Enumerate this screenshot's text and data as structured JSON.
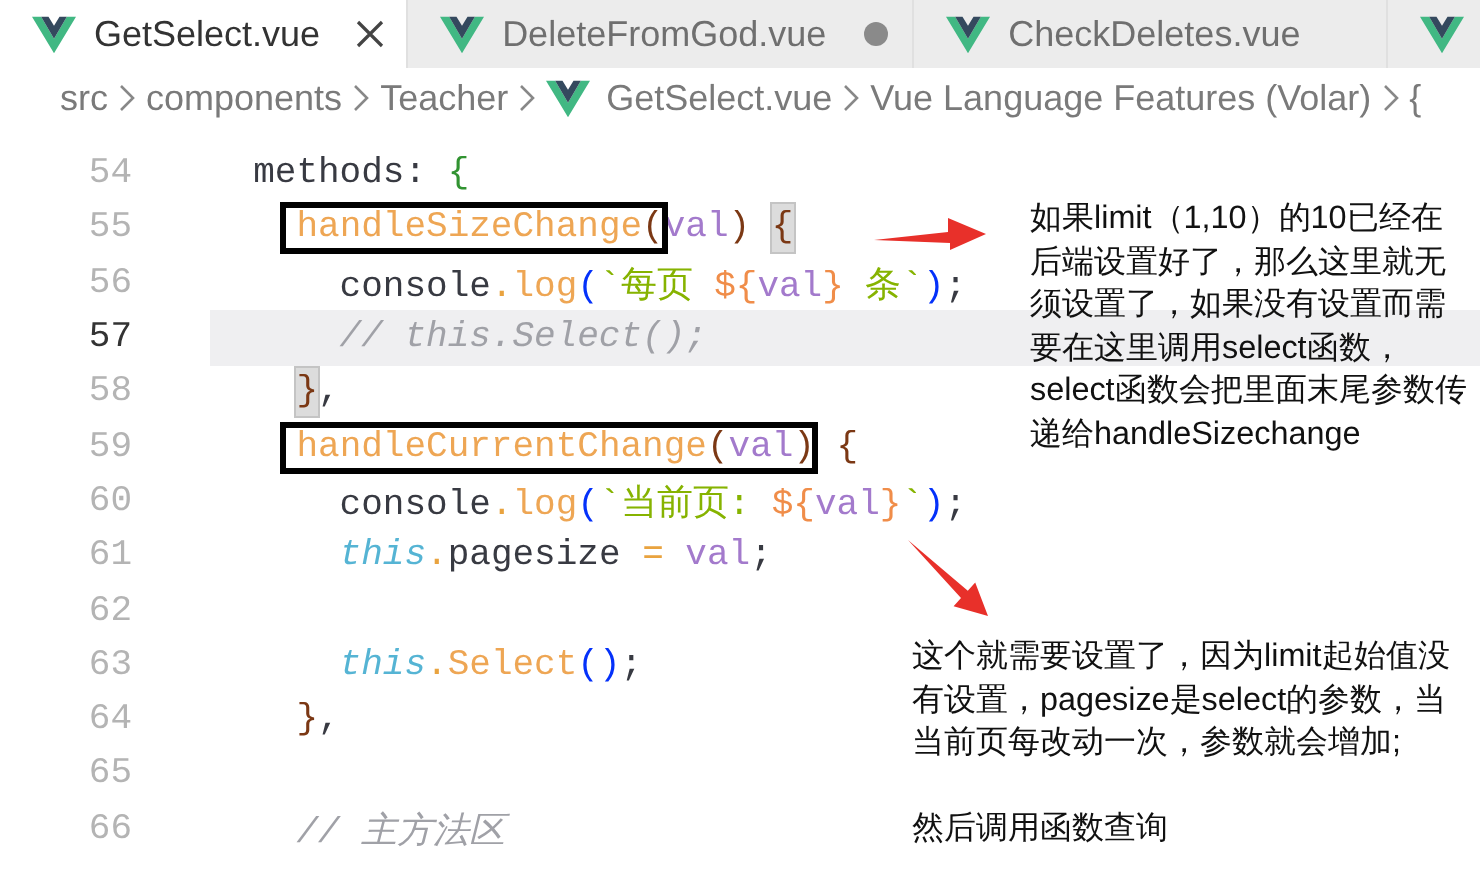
{
  "tabs": [
    {
      "label": "GetSelect.vue",
      "selected": true,
      "dirty": false
    },
    {
      "label": "DeleteFromGod.vue",
      "selected": false,
      "dirty": true
    },
    {
      "label": "CheckDeletes.vue",
      "selected": false,
      "dirty": false
    },
    {
      "selected": false,
      "dirty": false
    }
  ],
  "breadcrumb": [
    {
      "label": "src",
      "kind": "folder"
    },
    {
      "label": "components",
      "kind": "folder"
    },
    {
      "label": "Teacher",
      "kind": "folder"
    },
    {
      "label": "GetSelect.vue",
      "kind": "file"
    },
    {
      "label": "Vue Language Features (Volar)",
      "kind": "section"
    },
    {
      "label": "{",
      "kind": "symbol"
    }
  ],
  "editor": {
    "lines": [
      {
        "number": "54",
        "current": false,
        "tokens": [
          {
            "text": "  methods",
            "kind": "plain"
          },
          {
            "text": ": ",
            "kind": "plain"
          },
          {
            "text": "{",
            "kind": "bracket1"
          }
        ]
      },
      {
        "number": "55",
        "current": false,
        "tokens": [
          {
            "text": "    handleSizeChange",
            "kind": "func",
            "boxed": true
          },
          {
            "text": "(",
            "kind": "bracket2",
            "boxed": true
          },
          {
            "text": "val",
            "kind": "param"
          },
          {
            "text": ") ",
            "kind": "bracket2"
          },
          {
            "text": "{",
            "kind": "bracket2",
            "matched": true
          }
        ]
      },
      {
        "number": "56",
        "current": false,
        "tokens": [
          {
            "text": "      console",
            "kind": "plain"
          },
          {
            "text": ".",
            "kind": "operator"
          },
          {
            "text": "log",
            "kind": "func"
          },
          {
            "text": "(",
            "kind": "bracket3"
          },
          {
            "text": "`每页 ",
            "kind": "string"
          },
          {
            "text": "${",
            "kind": "interp"
          },
          {
            "text": "val",
            "kind": "param"
          },
          {
            "text": "}",
            "kind": "interp"
          },
          {
            "text": " 条`",
            "kind": "string"
          },
          {
            "text": ")",
            "kind": "bracket3"
          },
          {
            "text": ";",
            "kind": "plain"
          }
        ]
      },
      {
        "number": "57",
        "current": true,
        "tokens": [
          {
            "text": "      // this.Select();",
            "kind": "comment"
          }
        ]
      },
      {
        "number": "58",
        "current": false,
        "tokens": [
          {
            "text": "    }",
            "kind": "bracket2",
            "matched": true
          },
          {
            "text": ",",
            "kind": "plain"
          }
        ]
      },
      {
        "number": "59",
        "current": false,
        "tokens": [
          {
            "text": "    handleCurrentChange",
            "kind": "func",
            "boxed": true
          },
          {
            "text": "(",
            "kind": "bracket2",
            "boxed": true
          },
          {
            "text": "val",
            "kind": "param",
            "boxed": true
          },
          {
            "text": ")",
            "kind": "bracket2",
            "boxed": true
          },
          {
            "text": " {",
            "kind": "bracket2"
          }
        ]
      },
      {
        "number": "60",
        "current": false,
        "tokens": [
          {
            "text": "      console",
            "kind": "plain"
          },
          {
            "text": ".",
            "kind": "operator"
          },
          {
            "text": "log",
            "kind": "func"
          },
          {
            "text": "(",
            "kind": "bracket3"
          },
          {
            "text": "`当前页: ",
            "kind": "string"
          },
          {
            "text": "${",
            "kind": "interp"
          },
          {
            "text": "val",
            "kind": "param"
          },
          {
            "text": "}",
            "kind": "interp"
          },
          {
            "text": "`",
            "kind": "string"
          },
          {
            "text": ")",
            "kind": "bracket3"
          },
          {
            "text": ";",
            "kind": "plain"
          }
        ]
      },
      {
        "number": "61",
        "current": false,
        "tokens": [
          {
            "text": "      this",
            "kind": "this"
          },
          {
            "text": ".",
            "kind": "operator"
          },
          {
            "text": "pagesize ",
            "kind": "plain"
          },
          {
            "text": "= ",
            "kind": "operator"
          },
          {
            "text": "val",
            "kind": "param"
          },
          {
            "text": ";",
            "kind": "plain"
          }
        ]
      },
      {
        "number": "62",
        "current": false
      },
      {
        "number": "63",
        "current": false,
        "tokens": [
          {
            "text": "      this",
            "kind": "this"
          },
          {
            "text": ".",
            "kind": "operator"
          },
          {
            "text": "Select",
            "kind": "func"
          },
          {
            "text": "()",
            "kind": "bracket3"
          },
          {
            "text": ";",
            "kind": "plain"
          }
        ]
      },
      {
        "number": "64",
        "current": false,
        "tokens": [
          {
            "text": "    }",
            "kind": "bracket2"
          },
          {
            "text": ",",
            "kind": "plain"
          }
        ]
      },
      {
        "number": "65",
        "current": false
      },
      {
        "number": "66",
        "current": false,
        "tokens": [
          {
            "text": "    // 主方法区",
            "kind": "comment"
          }
        ]
      }
    ]
  },
  "annotations": [
    {
      "kind": "arrow"
    },
    {
      "kind": "note",
      "paragraphs": [
        "如果limit（1,10）的10已经在后端设置好了，那么这里就无须设置了，如果没有设置而需要在这里调用select函数，select函数会把里面末尾参数传递给handleSizechange"
      ]
    },
    {
      "kind": "arrow"
    },
    {
      "kind": "note",
      "paragraphs": [
        "这个就需要设置了，因为limit起始值没有设置，pagesize是select的参数，当当前页每改动一次，参数就会增加;",
        "然后调用函数查询"
      ]
    }
  ]
}
